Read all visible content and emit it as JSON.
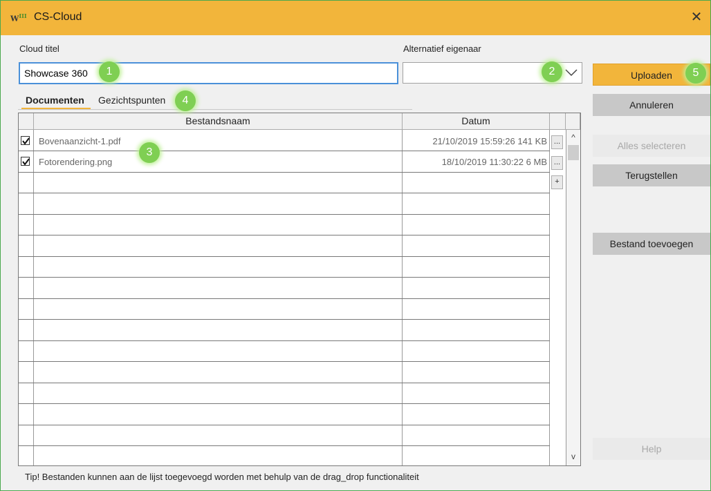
{
  "window": {
    "title": "CS-Cloud",
    "icon_text": "W",
    "icon_sup": "III",
    "close_label": "✕"
  },
  "form": {
    "cloud_title_label": "Cloud titel",
    "cloud_title_value": "Showcase 360",
    "owner_label": "Alternatief eigenaar",
    "owner_value": ""
  },
  "tabs": [
    {
      "label": "Documenten",
      "active": true
    },
    {
      "label": "Gezichtspunten",
      "active": false
    }
  ],
  "table": {
    "columns": [
      "Bestandsnaam",
      "Datum"
    ],
    "rows": [
      {
        "checked": true,
        "name": "Bovenaanzicht-1.pdf",
        "date": "21/10/2019 15:59:26",
        "size": "141 KB",
        "action": "..."
      },
      {
        "checked": true,
        "name": "Fotorendering.png",
        "date": "18/10/2019 11:30:22",
        "size": "6 MB",
        "action": "..."
      }
    ],
    "add_button": "+",
    "scroll_up": "^",
    "scroll_down": "v"
  },
  "buttons": {
    "upload": "Uploaden",
    "cancel": "Annuleren",
    "select_all": "Alles selecteren",
    "reset": "Terugstellen",
    "add_file": "Bestand toevoegen",
    "help": "Help"
  },
  "badges": [
    "1",
    "2",
    "3",
    "4",
    "5"
  ],
  "tip": "Tip! Bestanden kunnen aan de lijst toegevoegd worden met behulp van de drag_drop functionaliteit",
  "colors": {
    "accent": "#f2b53b",
    "badge": "#7fcf53",
    "window_border": "#4aa84e",
    "button_gray": "#c8c8c8"
  }
}
